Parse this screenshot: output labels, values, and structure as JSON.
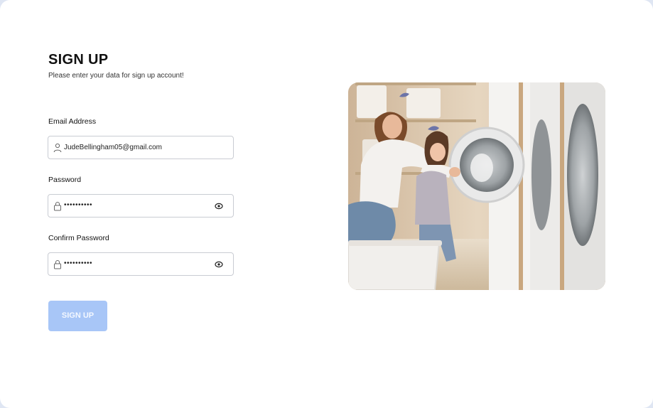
{
  "header": {
    "title": "SIGN UP",
    "subtitle": "Please enter your data for sign up account!"
  },
  "form": {
    "email": {
      "label": "Email Address",
      "value": "JudeBellingham05@gmail.com",
      "icon": "user-icon"
    },
    "password": {
      "label": "Password",
      "value": "••••••••••",
      "icon": "lock-icon",
      "toggle_icon": "eye-icon"
    },
    "confirm_password": {
      "label": "Confirm Password",
      "value": "••••••••••",
      "icon": "lock-icon",
      "toggle_icon": "eye-icon"
    },
    "submit_label": "SIGN UP"
  },
  "colors": {
    "button": "#a8c6f7",
    "border": "#c9ccd3",
    "text": "#111111"
  },
  "image": {
    "icon": "laundry-photo"
  }
}
